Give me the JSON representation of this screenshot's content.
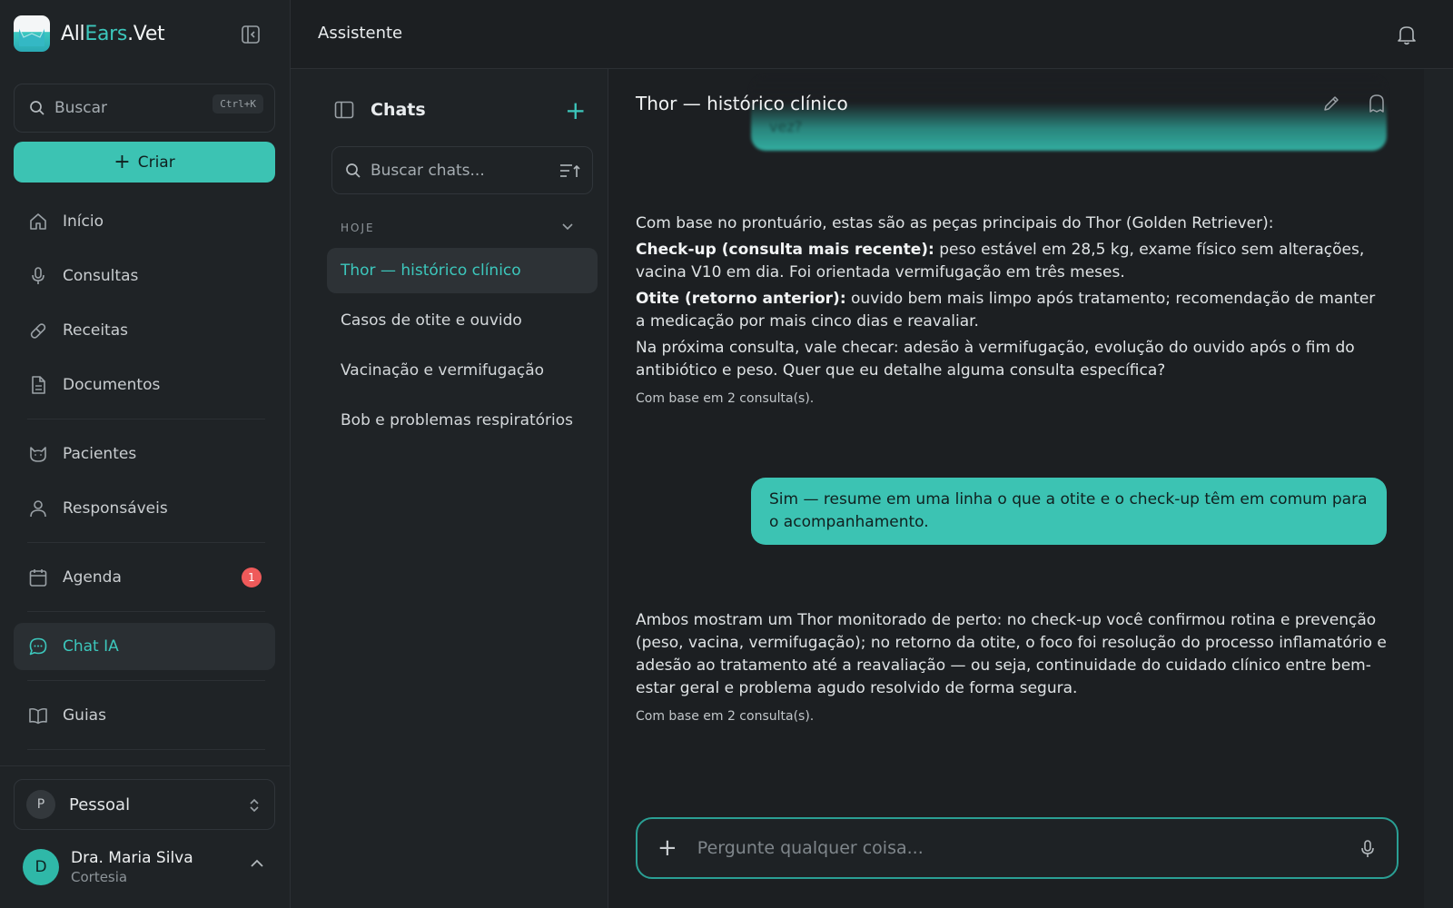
{
  "brand": {
    "name_prefix": "All",
    "name_accent": "Ears",
    "name_suffix": ".Vet"
  },
  "sidebar": {
    "search_placeholder": "Buscar",
    "search_shortcut": "Ctrl+K",
    "create_label": "Criar",
    "items": [
      {
        "label": "Início",
        "icon": "home-icon"
      },
      {
        "label": "Consultas",
        "icon": "microphone-icon"
      },
      {
        "label": "Receitas",
        "icon": "pill-icon"
      },
      {
        "label": "Documentos",
        "icon": "document-icon"
      },
      {
        "label": "Pacientes",
        "icon": "cat-icon"
      },
      {
        "label": "Responsáveis",
        "icon": "user-icon"
      },
      {
        "label": "Agenda",
        "icon": "calendar-icon",
        "badge": "1"
      },
      {
        "label": "Chat IA",
        "icon": "chat-icon",
        "active": true
      },
      {
        "label": "Guias",
        "icon": "book-icon"
      }
    ],
    "workspace": {
      "initial": "P",
      "label": "Pessoal"
    },
    "user": {
      "initial": "D",
      "name": "Dra. Maria Silva",
      "plan": "Cortesia"
    }
  },
  "topbar": {
    "title": "Assistente"
  },
  "chatlist": {
    "title": "Chats",
    "search_placeholder": "Buscar chats...",
    "section": "HOJE",
    "items": [
      {
        "label": "Thor — histórico clínico",
        "active": true
      },
      {
        "label": "Casos de otite e ouvido"
      },
      {
        "label": "Vacinação e vermifugação"
      },
      {
        "label": "Bob e problemas respiratórios"
      }
    ]
  },
  "conversation": {
    "title": "Thor — histórico clínico",
    "faded_user_tail": "vez?",
    "ai_message_1": {
      "intro": "Com base no prontuário, estas são as peças principais do Thor (Golden Retriever):",
      "point1_label": "Check-up (consulta mais recente):",
      "point1_text": " peso estável em 28,5 kg, exame físico sem alterações, vacina V10 em dia. Foi orientada vermifugação em três meses.",
      "point2_label": "Otite (retorno anterior):",
      "point2_text": " ouvido bem mais limpo após tratamento; recomendação de manter a medicação por mais cinco dias e reavaliar.",
      "closing": "Na próxima consulta, vale checar: adesão à vermifugação, evolução do ouvido após o fim do antibiótico e peso. Quer que eu detalhe alguma consulta específica?",
      "source": "Com base em 2 consulta(s)."
    },
    "user_message": "Sim — resume em uma linha o que a otite e o check-up têm em comum para o acompanhamento.",
    "ai_message_2": {
      "text": "Ambos mostram um Thor monitorado de perto: no check-up você confirmou rotina e prevenção (peso, vacina, vermifugação); no retorno da otite, o foco foi resolução do processo inflamatório e adesão ao tratamento até a reavaliação — ou seja, continuidade do cuidado clínico entre bem-estar geral e problema agudo resolvido de forma segura.",
      "source": "Com base em 2 consulta(s)."
    },
    "composer_placeholder": "Pergunte qualquer coisa..."
  },
  "colors": {
    "accent": "#3cc7bc",
    "badge": "#ef5a5a",
    "background": "#1c1f22"
  }
}
